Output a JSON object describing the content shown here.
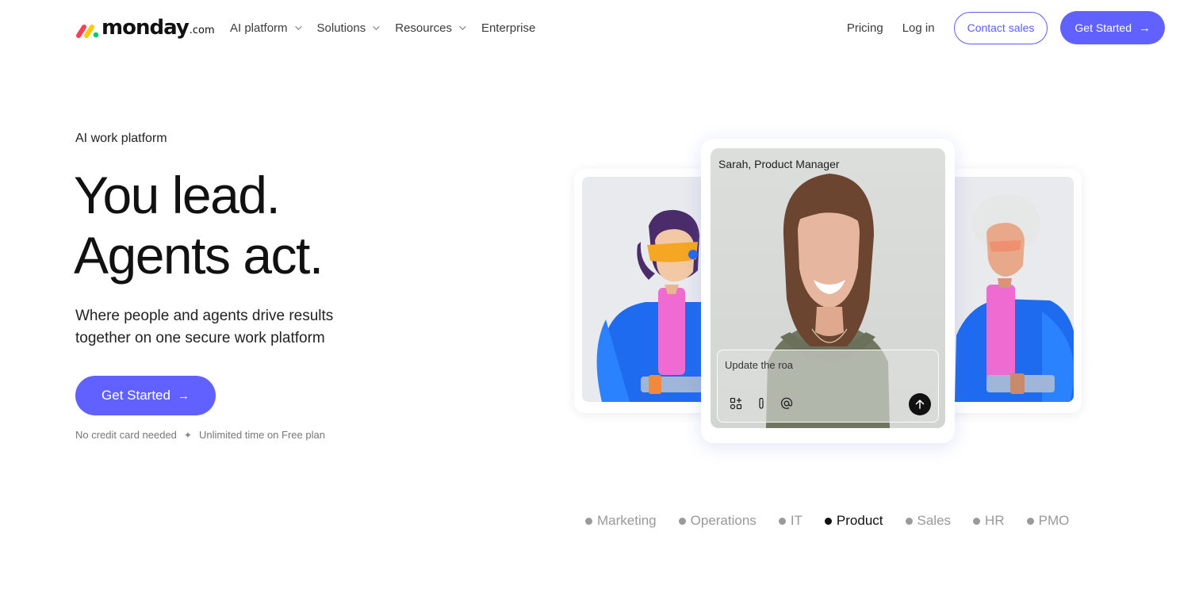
{
  "header": {
    "logo": {
      "name": "monday",
      "suffix": ".com"
    },
    "nav": [
      {
        "label": "AI platform",
        "dropdown": true
      },
      {
        "label": "Solutions",
        "dropdown": true
      },
      {
        "label": "Resources",
        "dropdown": true
      },
      {
        "label": "Enterprise",
        "dropdown": false
      }
    ],
    "pricing_label": "Pricing",
    "login_label": "Log in",
    "contact_label": "Contact sales",
    "get_started_label": "Get Started"
  },
  "hero": {
    "eyebrow": "AI work platform",
    "headline_line1": "You lead.",
    "headline_line2": "Agents act.",
    "subtext": "Where people and agents drive results together on one secure work platform",
    "cta_label": "Get Started",
    "fineprint_left": "No credit card needed",
    "fineprint_right": "Unlimited time on Free plan"
  },
  "agent_card": {
    "person_label": "Sarah, Product Manager",
    "prompt_text": "Update the roa",
    "icons": [
      "apps-icon",
      "paperclip-icon",
      "at-icon",
      "send-arrow-icon"
    ]
  },
  "tabs": [
    {
      "label": "Marketing",
      "active": false
    },
    {
      "label": "Operations",
      "active": false
    },
    {
      "label": "IT",
      "active": false
    },
    {
      "label": "Product",
      "active": true
    },
    {
      "label": "Sales",
      "active": false
    },
    {
      "label": "HR",
      "active": false
    },
    {
      "label": "PMO",
      "active": false
    }
  ],
  "colors": {
    "primary": "#6161ff",
    "logo_red": "#ff3d57",
    "logo_yellow": "#ffcb00",
    "logo_green": "#00ca72"
  }
}
